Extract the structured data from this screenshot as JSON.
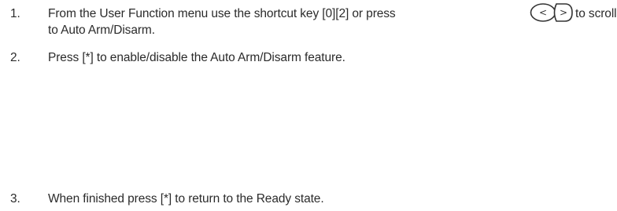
{
  "steps": [
    {
      "number": "1.",
      "text_part1": "From the User Function menu use the shortcut key [0][2] or press",
      "icon": "scroll-left-right-keys-icon",
      "text_after_icon": "to scroll",
      "text_line2": "to Auto Arm/Disarm."
    },
    {
      "number": "2.",
      "text": "Press [*] to enable/disable the Auto Arm/Disarm feature."
    },
    {
      "number": "3.",
      "text": "When finished press [*] to return to the Ready state."
    }
  ],
  "keys": {
    "left_glyph": "<",
    "right_glyph": ">"
  }
}
